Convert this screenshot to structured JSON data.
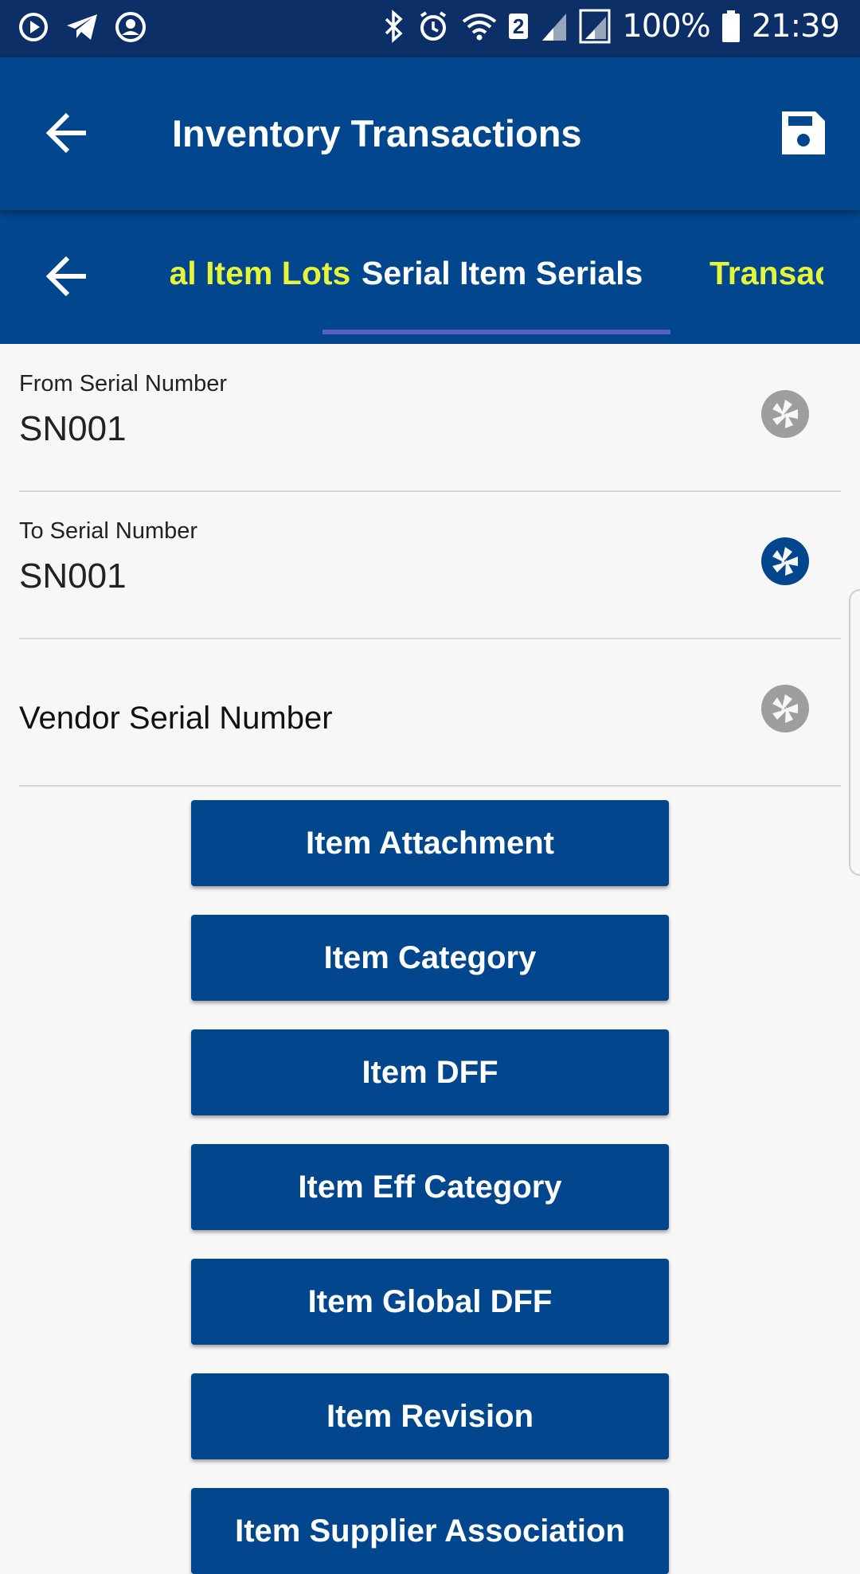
{
  "status_bar": {
    "battery": "100%",
    "time": "21:39",
    "notification_count": "2",
    "icons": [
      "play-icon",
      "telegram-icon",
      "account-icon",
      "bluetooth-icon",
      "alarm-icon",
      "wifi-icon",
      "signal-icon",
      "signal-icon",
      "battery-icon"
    ]
  },
  "appbar": {
    "title": "Inventory Transactions",
    "back_icon": "arrow-left-icon",
    "save_icon": "save-icon"
  },
  "tabs": [
    {
      "label": "Serial Item Lots",
      "visible_text": "em Lots",
      "active": false
    },
    {
      "label": "Serial Item Serials",
      "visible_text": "Serial Item Serials",
      "active": true
    },
    {
      "label": "Transactions",
      "visible_text": "Transac",
      "active": false
    }
  ],
  "fields": [
    {
      "label": "From Serial Number",
      "value": "SN001",
      "icon": "camera-shutter-icon",
      "icon_color": "#9e9e9e"
    },
    {
      "label": "To Serial Number",
      "value": "SN001",
      "icon": "camera-shutter-icon",
      "icon_color": "#02478d"
    },
    {
      "label": "Vendor Serial Number",
      "value": "",
      "icon": "camera-shutter-icon",
      "icon_color": "#9e9e9e"
    }
  ],
  "buttons": [
    "Item Attachment",
    "Item Category",
    "Item DFF",
    "Item Eff Category",
    "Item Global DFF",
    "Item Revision",
    "Item Supplier Association"
  ],
  "colors": {
    "primary": "#02478d",
    "status_bar": "#0b2f66",
    "tab_inactive": "#e5f53a",
    "tab_indicator": "#5a5fc7",
    "background": "#f7f7f7"
  }
}
